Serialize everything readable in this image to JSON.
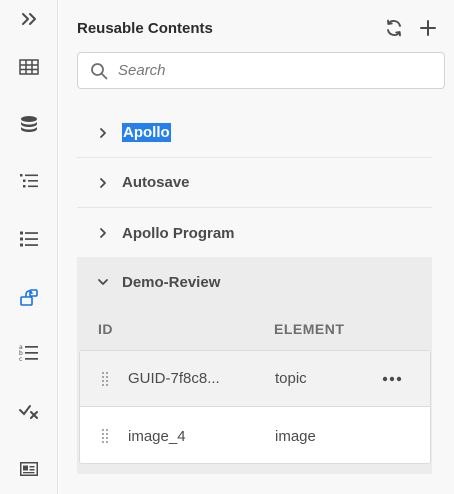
{
  "sidebar": {
    "items": [
      {
        "name": "expand",
        "icon": "double-chevron-right-icon"
      },
      {
        "name": "table",
        "icon": "table-icon"
      },
      {
        "name": "database",
        "icon": "database-icon"
      },
      {
        "name": "outline",
        "icon": "outline-list-icon"
      },
      {
        "name": "list",
        "icon": "bulleted-list-icon"
      },
      {
        "name": "reusable-content",
        "icon": "reusable-content-icon",
        "active": true
      },
      {
        "name": "abc-list",
        "icon": "abc-list-icon"
      },
      {
        "name": "checks",
        "icon": "check-x-icon"
      },
      {
        "name": "card",
        "icon": "id-card-icon"
      }
    ]
  },
  "panel": {
    "title": "Reusable Contents",
    "refresh_icon": "refresh-icon",
    "add_icon": "add-icon"
  },
  "search": {
    "placeholder": "Search",
    "value": ""
  },
  "tree": {
    "items": [
      {
        "label": "Apollo",
        "selected": true,
        "expanded": false
      },
      {
        "label": "Autosave",
        "selected": false,
        "expanded": false
      },
      {
        "label": "Apollo Program",
        "selected": false,
        "expanded": false
      },
      {
        "label": "Demo-Review",
        "selected": false,
        "expanded": true
      }
    ]
  },
  "table": {
    "columns": {
      "id": "ID",
      "element": "ELEMENT"
    },
    "rows": [
      {
        "id": "GUID-7f8c8...",
        "element": "topic",
        "has_more_menu": true
      },
      {
        "id": "image_4",
        "element": "image",
        "has_more_menu": false
      }
    ]
  },
  "colors": {
    "accent": "#1473e6",
    "selection": "#2680eb",
    "panel_bg": "#f8f8f8",
    "expanded_bg": "#ececec"
  }
}
